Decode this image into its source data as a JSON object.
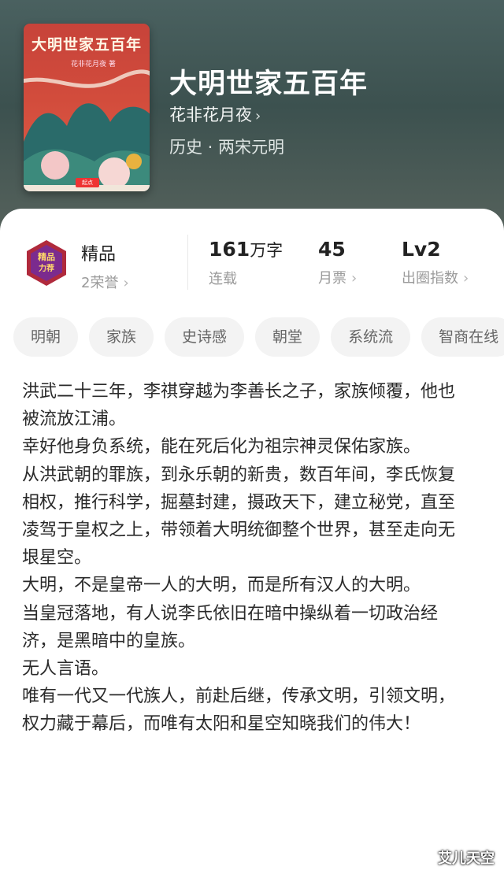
{
  "book": {
    "cover_title": "大明世家五百年",
    "cover_author": "花非花月夜 著",
    "cover_badge": "起点",
    "title": "大明世家五百年",
    "author": "花非花月夜",
    "genre": "历史 · 两宋元明"
  },
  "stats": {
    "quality_label": "精品",
    "honors": "2荣誉",
    "words_value": "161",
    "words_unit": "万字",
    "status": "连载",
    "tickets_value": "45",
    "tickets_label": "月票",
    "level_value": "Lv2",
    "level_label": "出圈指数"
  },
  "tags": [
    "明朝",
    "家族",
    "史诗感",
    "朝堂",
    "系统流",
    "智商在线"
  ],
  "synopsis": [
    "洪武二十三年，李祺穿越为李善长之子，家族倾覆，他也被流放江浦。",
    "幸好他身负系统，能在死后化为祖宗神灵保佑家族。",
    "从洪武朝的罪族，到永乐朝的新贵，数百年间，李氏恢复相权，推行科学，掘墓封建，摄政天下，建立秘党，直至凌驾于皇权之上，带领着大明统御整个世界，甚至走向无垠星空。",
    "大明，不是皇帝一人的大明，而是所有汉人的大明。",
    "当皇冠落地，有人说李氏依旧在暗中操纵着一切政治经济，是黑暗中的皇族。",
    "无人言语。",
    "唯有一代又一代族人，前赴后继，传承文明，引领文明，权力藏于幕后，而唯有太阳和星空知晓我们的伟大！"
  ],
  "watermark": "艾儿天空",
  "icons": {
    "chevron": "chevron-right-icon",
    "medal": "quality-medal-icon"
  },
  "colors": {
    "hero_bg": "#4a6160",
    "cover_red": "#d24c3c",
    "tag_bg": "#f3f3f3"
  }
}
